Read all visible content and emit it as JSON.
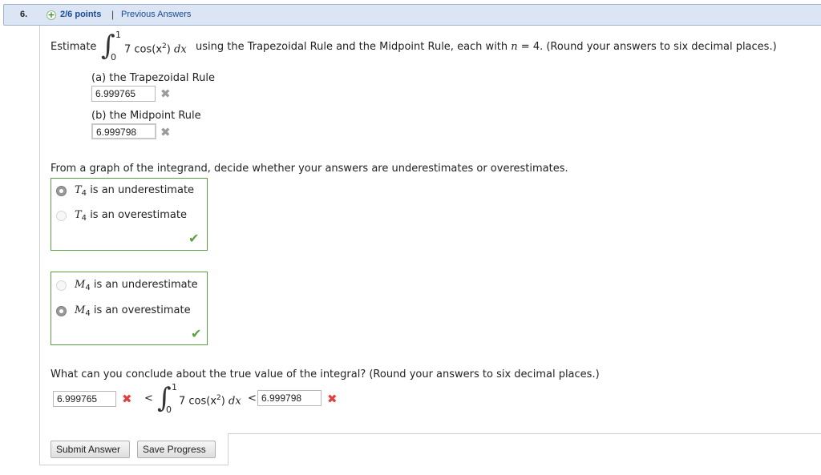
{
  "header": {
    "number": "6.",
    "points": "2/6 points",
    "separator": "|",
    "previous_answers": "Previous Answers"
  },
  "question": {
    "estimate_word": "Estimate",
    "integral": {
      "lower": "0",
      "upper": "1",
      "integrand": "7 cos(x",
      "exp": "2",
      "close": ")",
      "dx": "dx"
    },
    "instruction": "using the Trapezoidal Rule and the Midpoint Rule, each with",
    "n_var": "n",
    "n_value": "= 4. (Round your answers to six decimal places.)"
  },
  "part_a": {
    "label": "(a) the Trapezoidal Rule",
    "value": "6.999765"
  },
  "part_b": {
    "label": "(b) the Midpoint Rule",
    "value": "6.999798"
  },
  "graph_prompt": "From a graph of the integrand, decide whether your answers are underestimates or overestimates.",
  "t_choices": {
    "options": [
      {
        "var": "T",
        "sub": "4",
        "text": "is an underestimate",
        "selected": true
      },
      {
        "var": "T",
        "sub": "4",
        "text": "is an overestimate",
        "selected": false
      }
    ]
  },
  "m_choices": {
    "options": [
      {
        "var": "M",
        "sub": "4",
        "text": "is an underestimate",
        "selected": false
      },
      {
        "var": "M",
        "sub": "4",
        "text": "is an overestimate",
        "selected": true
      }
    ]
  },
  "conclusion": {
    "prompt": "What can you conclude about the true value of the integral? (Round your answers to six decimal places.)",
    "left_value": "6.999765",
    "lt": "<",
    "right_value": "6.999798"
  },
  "buttons": {
    "submit": "Submit Answer",
    "save": "Save Progress"
  },
  "colors": {
    "correct": "#5aa13f",
    "incorrect": "#e04040",
    "link": "#1a4a9c"
  },
  "icons": {
    "incorrect": "cross-icon",
    "correct": "check-icon",
    "points": "plus-circle-icon"
  }
}
